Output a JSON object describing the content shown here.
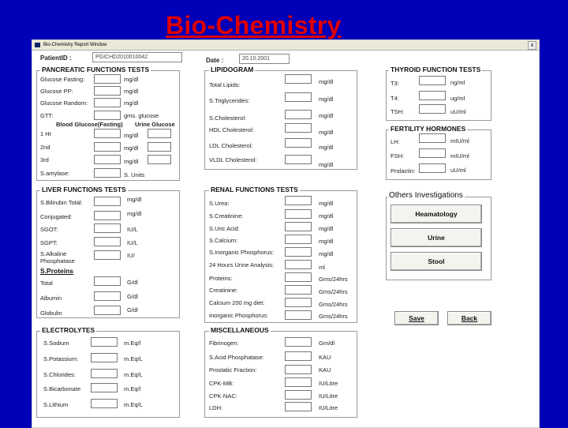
{
  "slide": {
    "title": "Bio-Chemistry"
  },
  "window": {
    "title": "Bio-Chemistry Report Window",
    "close": "x"
  },
  "patient": {
    "id_label": "PatientID :",
    "id_value": "PGICHD2010010042",
    "date_label": "Date :",
    "date_value": "20.10.2001"
  },
  "pancreatic": {
    "title": "PANCREATIC FUNCTIONS TESTS",
    "rows": [
      {
        "label": "Glucose Fasting:",
        "unit": "mg/dl"
      },
      {
        "label": "Glucose PP:",
        "unit": "mg/dl"
      },
      {
        "label": "Glucose Random:",
        "unit": "mg/dl"
      }
    ],
    "gtt_label": "GTT:",
    "gtt_unit": "gms. glucose",
    "blood_glucose_header": "Blood Glucose(Fasting)",
    "urine_glucose_header": "Urine Glucose",
    "time_rows": [
      {
        "label": "1 Hr",
        "unit": "mg/dl"
      },
      {
        "label": "2nd",
        "unit": "mg/dl"
      },
      {
        "label": "3rd",
        "unit": "mg/dl"
      }
    ],
    "amylase_label": "S.amylase:",
    "amylase_unit": "S. Units"
  },
  "liver": {
    "title": "LIVER FUNCTIONS TESTS",
    "rows": [
      {
        "label": "S.Bilirubin Total:",
        "unit": "mg/dl"
      },
      {
        "label": "Conjugated:",
        "unit": "mg/dl"
      },
      {
        "label": "SGOT:",
        "unit": "IU/L"
      },
      {
        "label": "SGPT:",
        "unit": "IU/L"
      },
      {
        "label": "S.Alkaline Phosphatase",
        "unit": "IU/"
      }
    ],
    "proteins_title": "S.Proteins",
    "protein_rows": [
      {
        "label": "Total",
        "unit": "G/dl"
      },
      {
        "label": "Albumin",
        "unit": "G/dl"
      },
      {
        "label": "Globulin",
        "unit": "G/dl"
      }
    ]
  },
  "electrolytes": {
    "title": "ELECTROLYTES",
    "rows": [
      {
        "label": "S.Sodium",
        "unit": "m.Eq/l"
      },
      {
        "label": "S.Potassium:",
        "unit": "m.Eq/L"
      },
      {
        "label": "S.Chlorides:",
        "unit": "m.Eq/L"
      },
      {
        "label": "S.Bicarbonate",
        "unit": "m.Eq/l"
      },
      {
        "label": "S.Lithium",
        "unit": "m.Eq/L"
      }
    ]
  },
  "lipidogram": {
    "title": "LIPIDOGRAM",
    "rows": [
      {
        "label": "Total Lipids:",
        "unit": "mg/dl"
      },
      {
        "label": "S.Triglycerides:",
        "unit": "mg/dl"
      },
      {
        "label": "S.Cholesterol:",
        "unit": "mg/dl"
      },
      {
        "label": "HDL Cholesterol:",
        "unit": "mg/dl"
      },
      {
        "label": "LDL Cholesterol:",
        "unit": "mg/dl"
      },
      {
        "label": "VLDL Cholesterol:",
        "unit": "mg/dl"
      }
    ]
  },
  "renal": {
    "title": "RENAL FUNCTIONS TESTS",
    "rows": [
      {
        "label": "S.Urea:",
        "unit": "mg/dl"
      },
      {
        "label": "S.Creatinine:",
        "unit": "mg/dl"
      },
      {
        "label": "S.Uric Acid:",
        "unit": "mg/dl"
      },
      {
        "label": "S.Calcium:",
        "unit": "mg/dl"
      },
      {
        "label": "S.Inorganic Phosphorus:",
        "unit": "mg/dl"
      },
      {
        "label": "24 Hours Urine Analysis:",
        "unit": "ml"
      },
      {
        "label": "Proteins:",
        "unit": "Gms/24hrs"
      },
      {
        "label": "Creatinine:",
        "unit": "Gms/24hrs"
      },
      {
        "label": "Calcium 200 mg diet:",
        "unit": "Gms/24hrs"
      },
      {
        "label": "Inorganic Phosphorus:",
        "unit": "Gms/24hrs"
      }
    ]
  },
  "misc": {
    "title": "MISCELLANEOUS",
    "rows": [
      {
        "label": "Fibrinogen:",
        "unit": "Gm/dl"
      },
      {
        "label": "S.Acid Phosphatase:",
        "unit": "KAU"
      },
      {
        "label": "Prostatic Fraction:",
        "unit": "KAU"
      },
      {
        "label": "CPK-MB:",
        "unit": "IU/Litre"
      },
      {
        "label": "CPK-NAC:",
        "unit": "IU/Litre"
      },
      {
        "label": "LDH:",
        "unit": "IU/Litre"
      }
    ]
  },
  "thyroid": {
    "title": "THYROID FUNCTION TESTS",
    "rows": [
      {
        "label": "T3:",
        "unit": "ng/ml"
      },
      {
        "label": "T4:",
        "unit": "ug/ml"
      },
      {
        "label": "TSH:",
        "unit": "uU/ml"
      }
    ]
  },
  "fertility": {
    "title": "FERTILITY HORMONES",
    "rows": [
      {
        "label": "LH:",
        "unit": "mIU/ml"
      },
      {
        "label": "FSH:",
        "unit": "mIU/ml"
      },
      {
        "label": "Prolactin:",
        "unit": "uU/ml"
      }
    ]
  },
  "others": {
    "title": "Others Investigations",
    "buttons": [
      "Heamatology",
      "Urine",
      "Stool"
    ]
  },
  "actions": {
    "save": "Save",
    "back": "Back"
  }
}
